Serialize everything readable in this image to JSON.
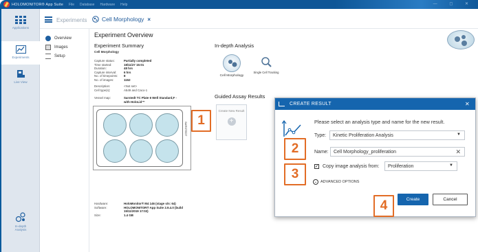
{
  "titlebar": {
    "app_title": "HOLOMONITOR® App Suite",
    "menu": [
      "File",
      "Database",
      "Hardware",
      "Help"
    ],
    "win_controls": "— ◻ ✕"
  },
  "rail": {
    "items": [
      {
        "label": "Applications"
      },
      {
        "label": "Experiments"
      },
      {
        "label": "Live View"
      },
      {
        "label": "In-depth Analysis"
      }
    ]
  },
  "topbar": {
    "breadcrumb": "Experiments",
    "tab_label": "Cell Morphology",
    "tab_close": "×"
  },
  "nav": {
    "items": [
      {
        "label": "Overview"
      },
      {
        "label": "Images"
      },
      {
        "label": "Setup"
      }
    ]
  },
  "overview": {
    "title": "Experiment Overview",
    "summary_title": "Experiment Summary",
    "experiment_name": "Cell Morphology",
    "fields": [
      {
        "k": "Capture status:",
        "v": "Partially completed"
      },
      {
        "k": "Time started:",
        "v": "18/11/27 15:01"
      },
      {
        "k": "Duration:",
        "v": "48 hrs"
      },
      {
        "k": "Capture interval:",
        "v": "6 hrs"
      },
      {
        "k": "No. of timepoints:",
        "v": "8"
      },
      {
        "k": "No. of images:",
        "v": "1152"
      }
    ],
    "desc_fields": [
      {
        "k": "Description:",
        "v": "<Not set>"
      },
      {
        "k": "Cell type(s):",
        "v": "A549 and Caco-1"
      }
    ],
    "vessel_key": "Vessel map:",
    "vessel_val": "Sarstedt TC Plate 6 Well Standard,F - with HoloLid™",
    "plate_brand": "SARSTEDT",
    "hw_fields": [
      {
        "k": "Hardware:",
        "v": "HoloMonitor® M4 146 (stage s/n: 64)"
      },
      {
        "k": "Software:",
        "v": "HOLOMONITOR® App Suite 2.9.4.0 (build 15/11/2019 17:02)"
      },
      {
        "k": "Size:",
        "v": "1.4 GB"
      }
    ]
  },
  "analysis": {
    "title": "In-depth Analysis",
    "items": [
      {
        "label": "Cell Morphology"
      },
      {
        "label": "Single Cell Tracking"
      }
    ],
    "guided_title": "Guided Assay Results",
    "create_tile": "Create New Result"
  },
  "dialog": {
    "title": "CREATE RESULT",
    "close": "✕",
    "prompt": "Please select an analysis type and name for the new result.",
    "type_label": "Type:",
    "type_value": "Kinetic Proliferation Analysis",
    "name_label": "Name:",
    "name_value": "Cell Morphology_proliferation",
    "copy_checked": "✓",
    "copy_label": "Copy image analysis from:",
    "copy_value": "Proliferation",
    "advanced": "ADVANCED OPTIONS",
    "create": "Create",
    "cancel": "Cancel"
  },
  "callouts": [
    "1",
    "2",
    "3",
    "4"
  ],
  "colors": {
    "accent": "#1565ae",
    "callout": "#e26c25",
    "rail": "#dfe6ee"
  }
}
